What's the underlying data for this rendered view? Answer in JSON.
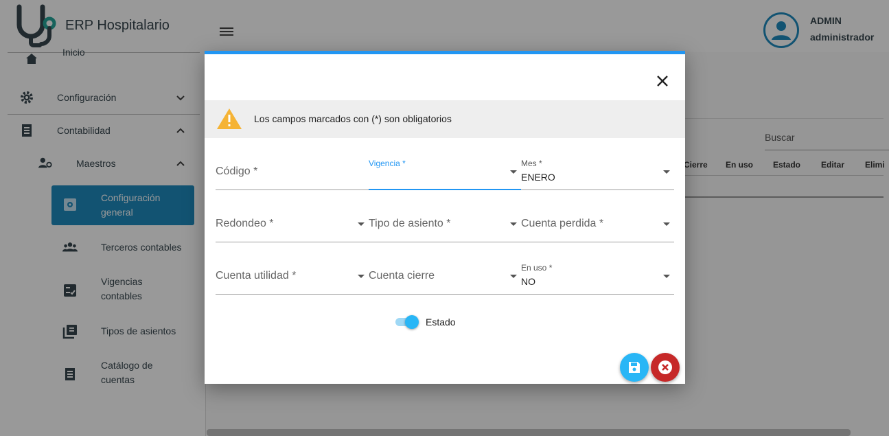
{
  "app": {
    "title": "ERP Hospitalario",
    "user_name": "ADMIN",
    "user_role": "administrador"
  },
  "sidebar": {
    "items": [
      {
        "label": "Inicio"
      },
      {
        "label": "Configuración"
      },
      {
        "label": "Contabilidad"
      },
      {
        "label": "Maestros"
      },
      {
        "label": "Configuración general"
      },
      {
        "label": "Terceros contables"
      },
      {
        "label": "Vigencias contables"
      },
      {
        "label": "Tipos de asientos"
      },
      {
        "label": "Catálogo de cuentas"
      }
    ]
  },
  "table": {
    "search_label": "Buscar",
    "headers": [
      "Cierre",
      "En uso",
      "Estado",
      "Editar",
      "Elimi"
    ]
  },
  "modal": {
    "notice": "Los campos marcados con (*) son obligatorios",
    "fields": {
      "codigo": {
        "label": "Código *"
      },
      "vigencia": {
        "label": "Vigencia *",
        "value": ""
      },
      "mes": {
        "label": "Mes *",
        "value": "ENERO"
      },
      "redondeo": {
        "label": "Redondeo *"
      },
      "tipo_asiento": {
        "label": "Tipo de asiento *"
      },
      "cuenta_perdida": {
        "label": "Cuenta perdida *"
      },
      "cuenta_utilidad": {
        "label": "Cuenta utilidad *"
      },
      "cuenta_cierre": {
        "label": "Cuenta cierre"
      },
      "en_uso": {
        "label": "En uso *",
        "value": "NO"
      }
    },
    "estado_label": "Estado",
    "estado_on": true
  },
  "colors": {
    "accent": "#2196f3",
    "primary": "#1f8bbf",
    "save": "#29b6f6",
    "cancel": "#c62828",
    "warning": "#f5b335"
  },
  "icons": {
    "logo": "stethoscope-icon",
    "menu": "hamburger-icon",
    "avatar": "account-circle-icon",
    "close": "close-icon",
    "warning": "warning-icon",
    "save": "floppy-disk-icon",
    "cancel": "cancel-circle-icon"
  }
}
